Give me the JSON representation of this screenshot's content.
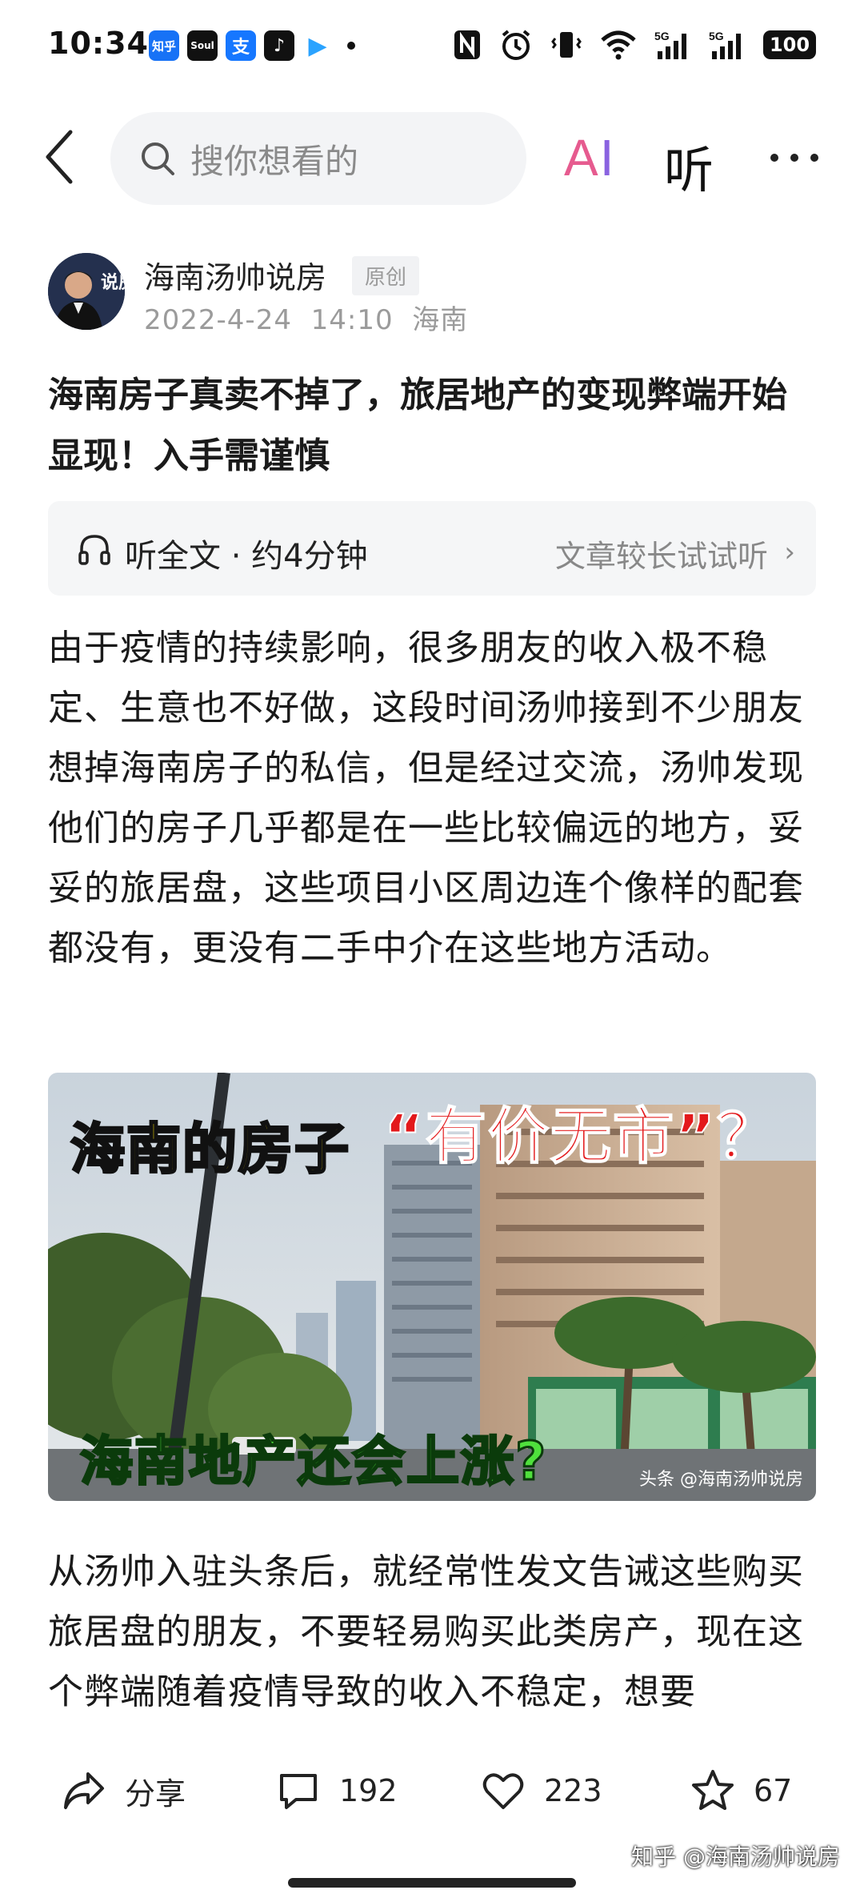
{
  "status_bar": {
    "time": "10:34",
    "apps": [
      {
        "name": "zhihu",
        "label": "知乎",
        "color": "#1772f6"
      },
      {
        "name": "soul",
        "label": "Soul",
        "color": "#111111"
      },
      {
        "name": "alipay",
        "label": "支",
        "color": "#1677ff"
      },
      {
        "name": "tiktok",
        "label": "♪",
        "color": "#111111"
      },
      {
        "name": "video",
        "label": "▶",
        "color": "#2aa3ff"
      }
    ],
    "signal_1": "5G",
    "signal_2": "5G",
    "battery": "100"
  },
  "top_nav": {
    "search_placeholder": "搜你想看的",
    "ai_label_a": "A",
    "ai_label_i": "I",
    "listen_label": "听"
  },
  "author": {
    "name": "海南汤帅说房",
    "badge": "原创",
    "date": "2022-4-24",
    "time": "14:10",
    "location": "海南",
    "avatar_text": "说房"
  },
  "article": {
    "title": "海南房子真卖不掉了，旅居地产的变现弊端开始显现！入手需谨慎",
    "listen_label": "听全文 · 约4分钟",
    "listen_hint": "文章较长试试听",
    "paragraph_1": "由于疫情的持续影响，很多朋友的收入极不稳定、生意也不好做，这段时间汤帅接到不少朋友想掉海南房子的私信，但是经过交流，汤帅发现他们的房子几乎都是在一些比较偏远的地方，妥妥的旅居盘，这些项目小区周边连个像样的配套都没有，更没有二手中介在这些地方活动。",
    "image": {
      "headline_top": "海南的房子",
      "headline_quote": "“有价无市”？",
      "headline_bottom": "海南地产还会上涨?",
      "watermark": "头条 @海南汤帅说房"
    },
    "paragraph_2": "从汤帅入驻头条后，就经常性发文告诫这些购买旅居盘的朋友，不要轻易购买此类房产，现在这个弊端随着疫情导致的收入不稳定，想要"
  },
  "bottom_bar": {
    "share_label": "分享",
    "comments_count": "192",
    "likes_count": "223",
    "favorites_count": "67"
  },
  "source_watermark": "知乎 @海南汤帅说房"
}
